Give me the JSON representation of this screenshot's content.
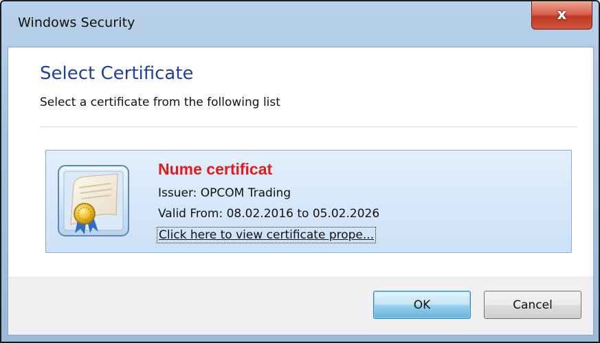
{
  "window": {
    "title": "Windows Security",
    "close_icon": "close-icon",
    "close_glyph": "x"
  },
  "dialog": {
    "heading": "Select Certificate",
    "subheading": "Select a certificate from the following list"
  },
  "certificate": {
    "icon": "certificate-icon",
    "name": "Nume certificat",
    "issuer": "Issuer: OPCOM Trading",
    "validity": "Valid From: 08.02.2016 to 05.02.2026",
    "link": "Click here to view certificate prope..."
  },
  "buttons": {
    "ok_label": "OK",
    "cancel_label": "Cancel"
  },
  "colors": {
    "heading": "#1f3fa6",
    "cert_name": "#e11b1b",
    "card_border": "#84acdd",
    "close_button": "#c8452c"
  }
}
